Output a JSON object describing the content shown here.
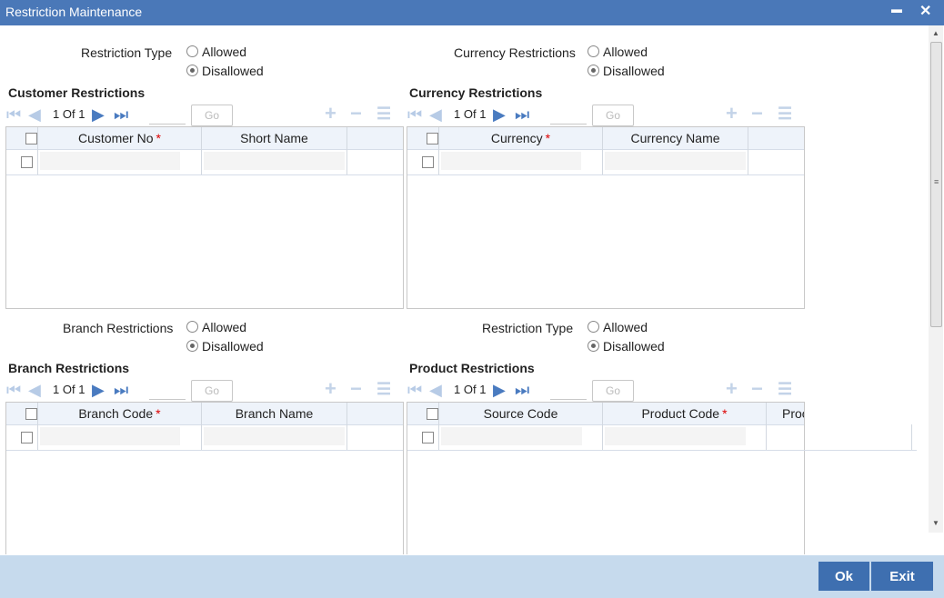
{
  "window": {
    "title": "Restriction Maintenance",
    "minimize": "▬",
    "close": "✕"
  },
  "top_left": {
    "label": "Restriction Type",
    "opt_allowed": "Allowed",
    "opt_disallowed": "Disallowed",
    "selected": "Disallowed"
  },
  "top_right": {
    "label": "Currency Restrictions",
    "opt_allowed": "Allowed",
    "opt_disallowed": "Disallowed",
    "selected": "Disallowed"
  },
  "customer_grid": {
    "title": "Customer Restrictions",
    "page": "1",
    "of": "Of",
    "total": "1",
    "go": "Go",
    "columns": [
      {
        "label": "Customer No",
        "required": "*"
      },
      {
        "label": "Short Name"
      }
    ]
  },
  "currency_grid": {
    "title": "Currency Restrictions",
    "page": "1",
    "of": "Of",
    "total": "1",
    "go": "Go",
    "columns": [
      {
        "label": "Currency",
        "required": "*"
      },
      {
        "label": "Currency Name"
      }
    ]
  },
  "mid_left": {
    "label": "Branch Restrictions",
    "opt_allowed": "Allowed",
    "opt_disallowed": "Disallowed",
    "selected": "Disallowed"
  },
  "mid_right": {
    "label": "Restriction Type",
    "opt_allowed": "Allowed",
    "opt_disallowed": "Disallowed",
    "selected": "Disallowed"
  },
  "branch_grid": {
    "title": "Branch Restrictions",
    "page": "1",
    "of": "Of",
    "total": "1",
    "go": "Go",
    "columns": [
      {
        "label": "Branch Code",
        "required": "*"
      },
      {
        "label": "Branch Name"
      }
    ]
  },
  "product_grid": {
    "title": "Product Restrictions",
    "page": "1",
    "of": "Of",
    "total": "1",
    "go": "Go",
    "columns": [
      {
        "label": "Source Code"
      },
      {
        "label": "Product Code",
        "required": "*"
      },
      {
        "label": "Proc"
      }
    ]
  },
  "icons": {
    "first": "first-page-icon",
    "prev": "prev-page-icon",
    "next": "next-page-icon",
    "last": "last-page-icon",
    "add": "add-row-icon",
    "delete": "delete-row-icon",
    "view": "view-list-icon"
  },
  "colors": {
    "titlebar": "#4a78b8",
    "footer": "#c6daed",
    "button": "#3e6fb0",
    "required": "#d00000"
  },
  "footer": {
    "ok": "Ok",
    "exit": "Exit"
  }
}
